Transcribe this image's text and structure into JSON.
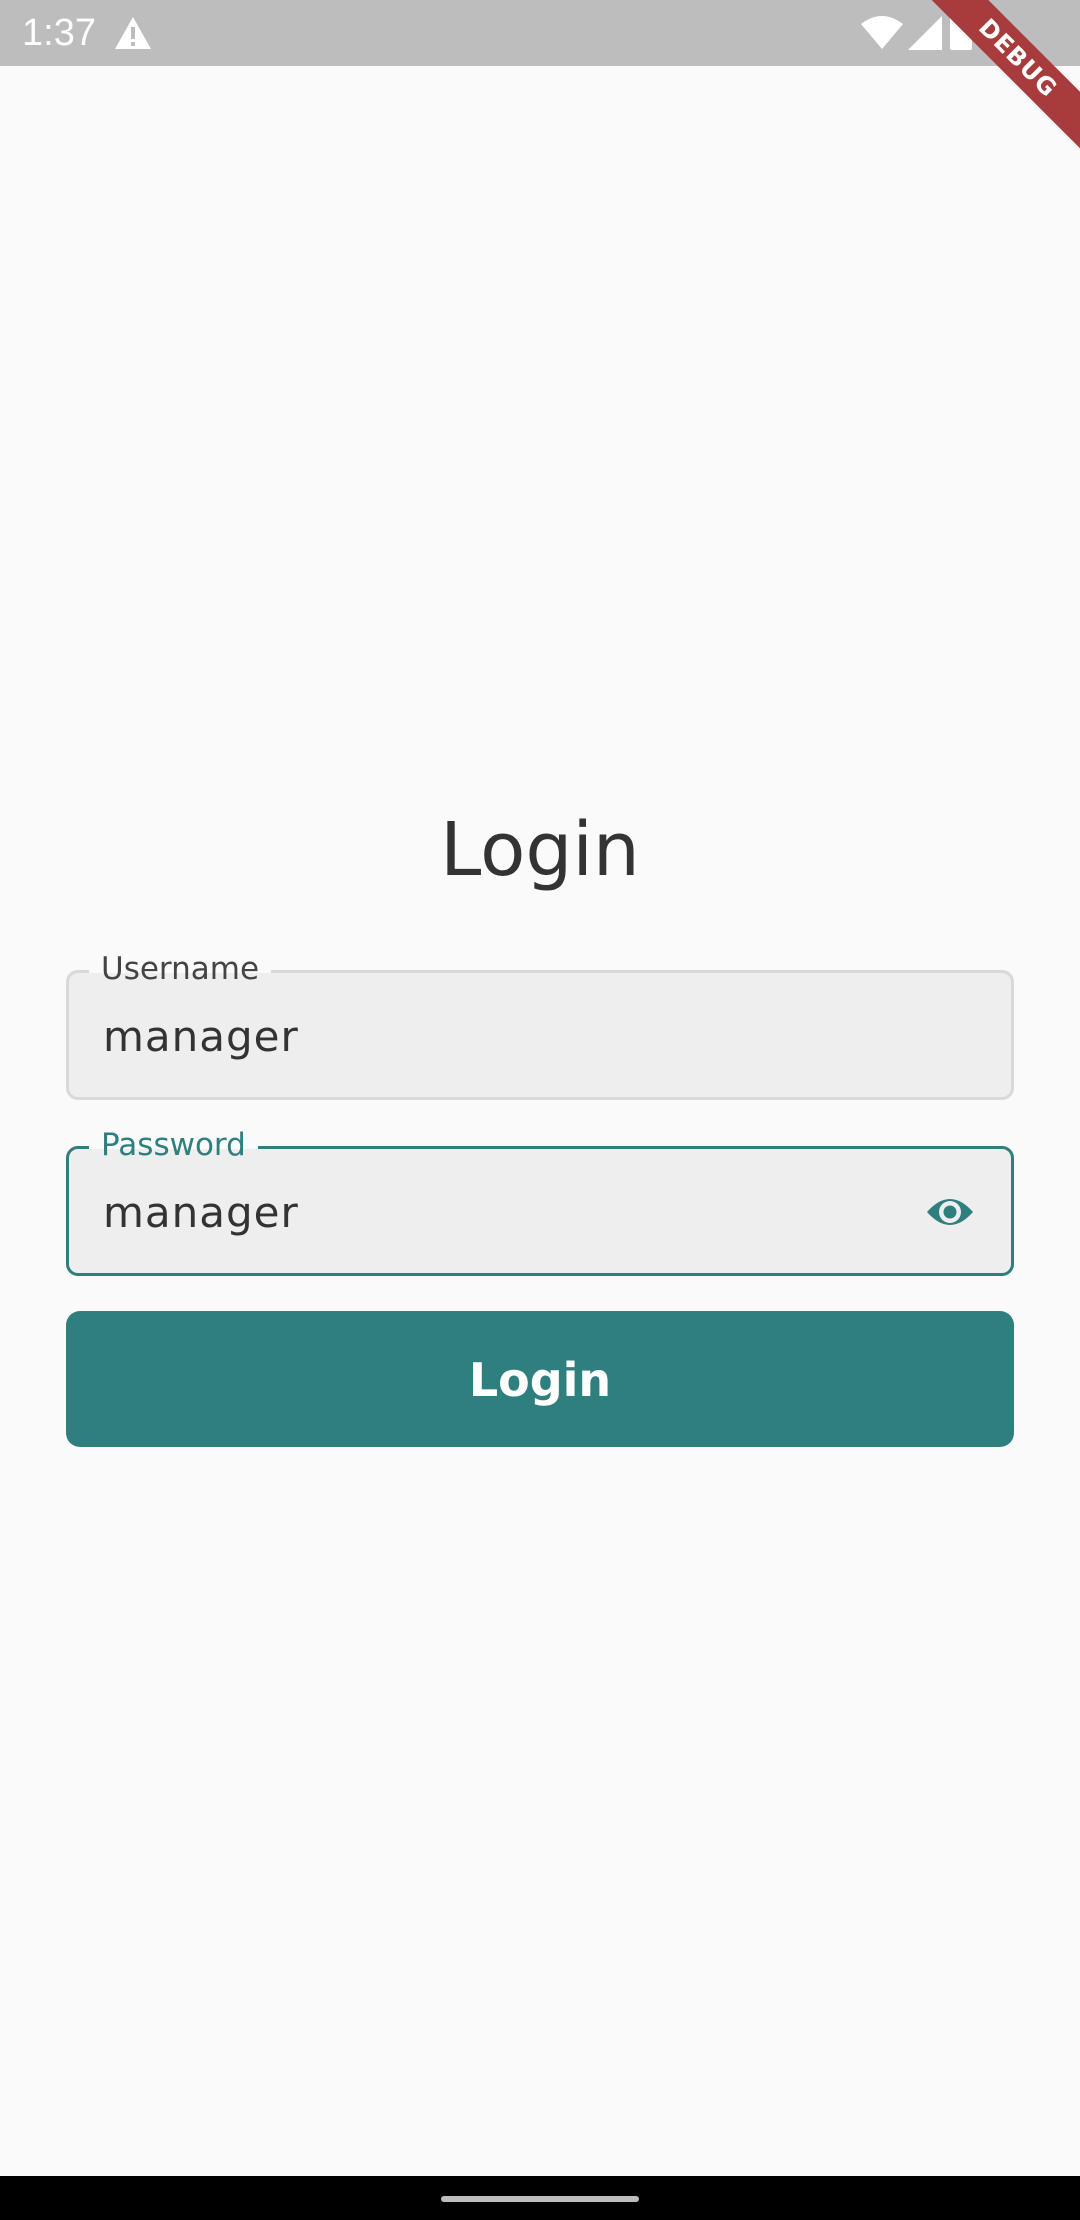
{
  "status_bar": {
    "time": "1:37",
    "icons": [
      "warning-icon",
      "wifi-icon",
      "signal-icon",
      "battery-icon"
    ]
  },
  "debug_banner": {
    "label": "DEBUG"
  },
  "login_form": {
    "title": "Login",
    "username": {
      "label": "Username",
      "value": "manager"
    },
    "password": {
      "label": "Password",
      "value": "manager",
      "toggle_icon": "eye-icon"
    },
    "submit_label": "Login"
  },
  "colors": {
    "accent": "#2e7f7e",
    "background": "#fafafa",
    "field_fill": "#eeeeee",
    "debug_banner": "#a83b3c"
  }
}
